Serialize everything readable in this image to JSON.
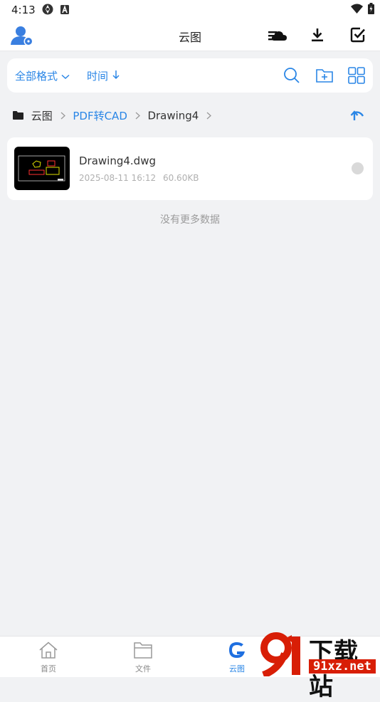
{
  "status_bar": {
    "time": "4:13"
  },
  "header": {
    "title": "云图"
  },
  "filters": {
    "format_label": "全部格式",
    "time_label": "时间"
  },
  "breadcrumb": {
    "root": "云图",
    "level1": "PDF转CAD",
    "current": "Drawing4"
  },
  "files": [
    {
      "name": "Drawing4.dwg",
      "date": "2025-08-11 16:12",
      "size": "60.60KB"
    }
  ],
  "empty_message": "没有更多数据",
  "bottom_nav": {
    "home": "首页",
    "files": "文件",
    "cloud": "云图",
    "active": "cloud"
  },
  "watermark": {
    "title": "下载站",
    "url": "91xz.net"
  },
  "colors": {
    "accent": "#2a86e6",
    "background": "#f1f2f4",
    "watermark_red": "#d81e06"
  }
}
